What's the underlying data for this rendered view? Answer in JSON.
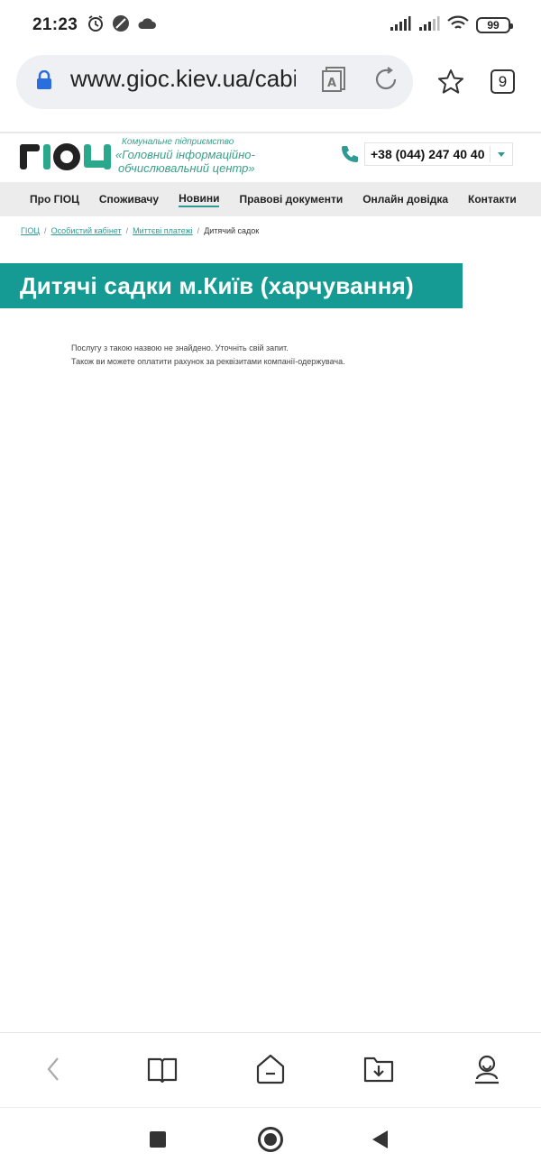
{
  "status_bar": {
    "time": "21:23",
    "battery": "99",
    "icons": [
      "alarm-icon",
      "no-data-icon",
      "cloud-icon",
      "signal-icon",
      "signal-icon",
      "wifi-icon",
      "battery-icon"
    ]
  },
  "browser": {
    "url": "www.gioc.kiev.ua/cabinet",
    "tabs_count": "9",
    "icons": [
      "lock-icon",
      "reader-mode-icon",
      "reload-icon",
      "star-icon"
    ]
  },
  "site": {
    "logo_text": "ГІОЦ",
    "tagline_small": "Комунальне підприємство",
    "tagline_line1": "«Головний  інформаційно-",
    "tagline_line2": "обчислювальний центр»",
    "phone": "+38 (044) 247 40 40",
    "accent_color": "#159b93"
  },
  "nav": {
    "items": [
      {
        "label": "Про ГІОЦ"
      },
      {
        "label": "Споживачу"
      },
      {
        "label": "Новини"
      },
      {
        "label": "Правові документи"
      },
      {
        "label": "Онлайн довідка"
      },
      {
        "label": "Контакти"
      }
    ]
  },
  "breadcrumb": {
    "items": [
      "ГІОЦ",
      "Особистий кабінет",
      "Миттєві платежі",
      "Дитячий садок"
    ]
  },
  "page": {
    "title": "Дитячі садки м.Київ (харчування)",
    "message_line1": "Послугу з такою назвою не знайдено. Уточніть свій запит.",
    "message_line2": "Також ви можете оплатити рахунок за реквізитами компанії-одержувача."
  },
  "bottom_toolbar": {
    "icons": [
      "back-icon",
      "book-icon",
      "home-icon",
      "downloads-folder-icon",
      "profile-icon"
    ]
  }
}
